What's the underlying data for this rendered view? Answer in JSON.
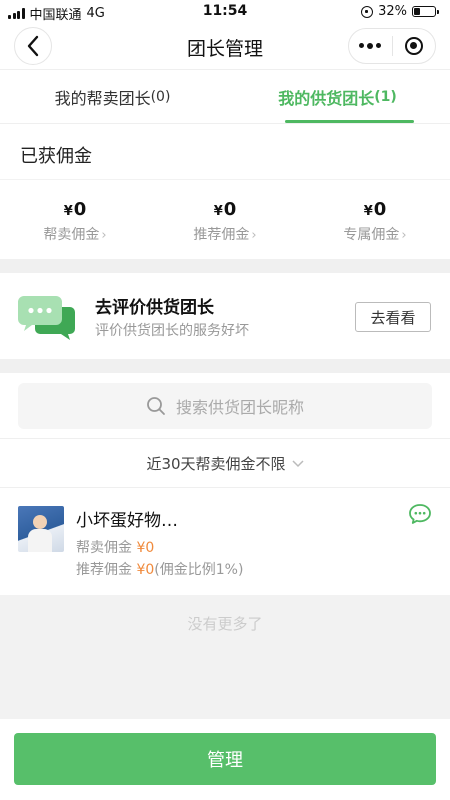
{
  "status_bar": {
    "carrier": "中国联通",
    "network": "4G",
    "time": "11:54",
    "battery": "32%",
    "battery_level": 0.32
  },
  "nav": {
    "title": "团长管理",
    "back_icon": "chevron-left-icon",
    "more_icon": "more-dots-icon",
    "close_icon": "target-circle-icon"
  },
  "tabs": [
    {
      "label": "我的帮卖团长",
      "count": "(0)",
      "active": false
    },
    {
      "label": "我的供货团长",
      "count": "(1)",
      "active": true
    }
  ],
  "commission": {
    "title": "已获佣金",
    "currency": "¥",
    "items": [
      {
        "value": "0",
        "label": "帮卖佣金"
      },
      {
        "value": "0",
        "label": "推荐佣金"
      },
      {
        "value": "0",
        "label": "专属佣金"
      }
    ]
  },
  "review_card": {
    "title": "去评价供货团长",
    "subtitle": "评价供货团长的服务好坏",
    "button": "去看看",
    "icon": "chat-bubbles-icon"
  },
  "search": {
    "placeholder": "搜索供货团长昵称"
  },
  "filter": {
    "label": "近30天帮卖佣金不限"
  },
  "list": [
    {
      "name": "小坏蛋好物…",
      "line1_label": "帮卖佣金",
      "line1_value": "¥0",
      "line2_label": "推荐佣金",
      "line2_value": "¥0",
      "line2_note": "(佣金比例1%)"
    }
  ],
  "list_end": "没有更多了",
  "bottom": {
    "button": "管理"
  },
  "colors": {
    "accent": "#4eb861",
    "button": "#57bf6a",
    "amount": "#f08a3c"
  }
}
